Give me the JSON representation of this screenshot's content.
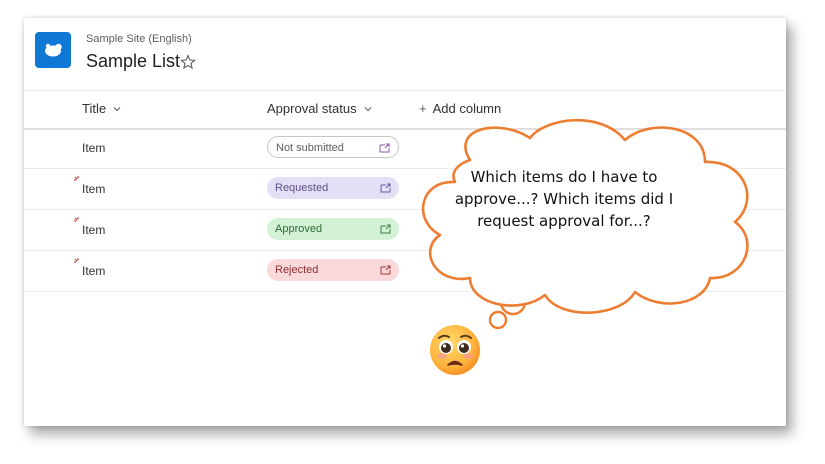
{
  "site": {
    "name": "Sample Site (English)",
    "list_title": "Sample List"
  },
  "columns": {
    "title": "Title",
    "approval_status": "Approval status",
    "add_column": "Add column"
  },
  "rows": [
    {
      "title": "Item",
      "status": "Not submitted"
    },
    {
      "title": "Item",
      "status": "Requested"
    },
    {
      "title": "Item",
      "status": "Approved"
    },
    {
      "title": "Item",
      "status": "Rejected"
    }
  ],
  "callout": {
    "text": "Which items do I have to approve...? Which items did I request approval for...?"
  },
  "colors": {
    "brand": "#0f78d4",
    "requested": "#e5dff5",
    "approved": "#d3f2d5",
    "rejected": "#fad9da",
    "cloud_stroke": "#ed7d31"
  },
  "icons": [
    "site-logo-icon",
    "star-icon",
    "chevron-down-icon",
    "plus-icon",
    "new-item-icon",
    "open-details-icon",
    "worried-face-icon"
  ]
}
